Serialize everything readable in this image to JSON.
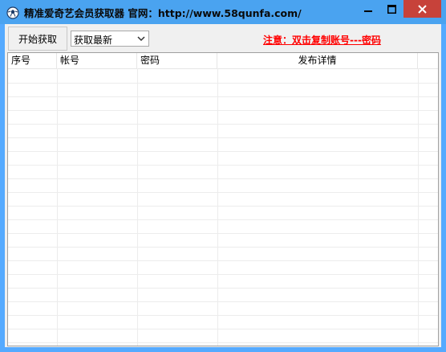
{
  "window": {
    "title": "精准爱奇艺会员获取器 官网：http://www.58qunfa.com/",
    "accent": "#4aa3f0",
    "close_color": "#c7423a"
  },
  "toolbar": {
    "start_label": "开始获取",
    "mode_select_value": "获取最新",
    "notice": "注意：双击复制账号---密码",
    "notice_color": "#ff0000"
  },
  "table": {
    "columns": [
      "序号",
      "帐号",
      "密码",
      "发布详情"
    ],
    "rows": []
  }
}
